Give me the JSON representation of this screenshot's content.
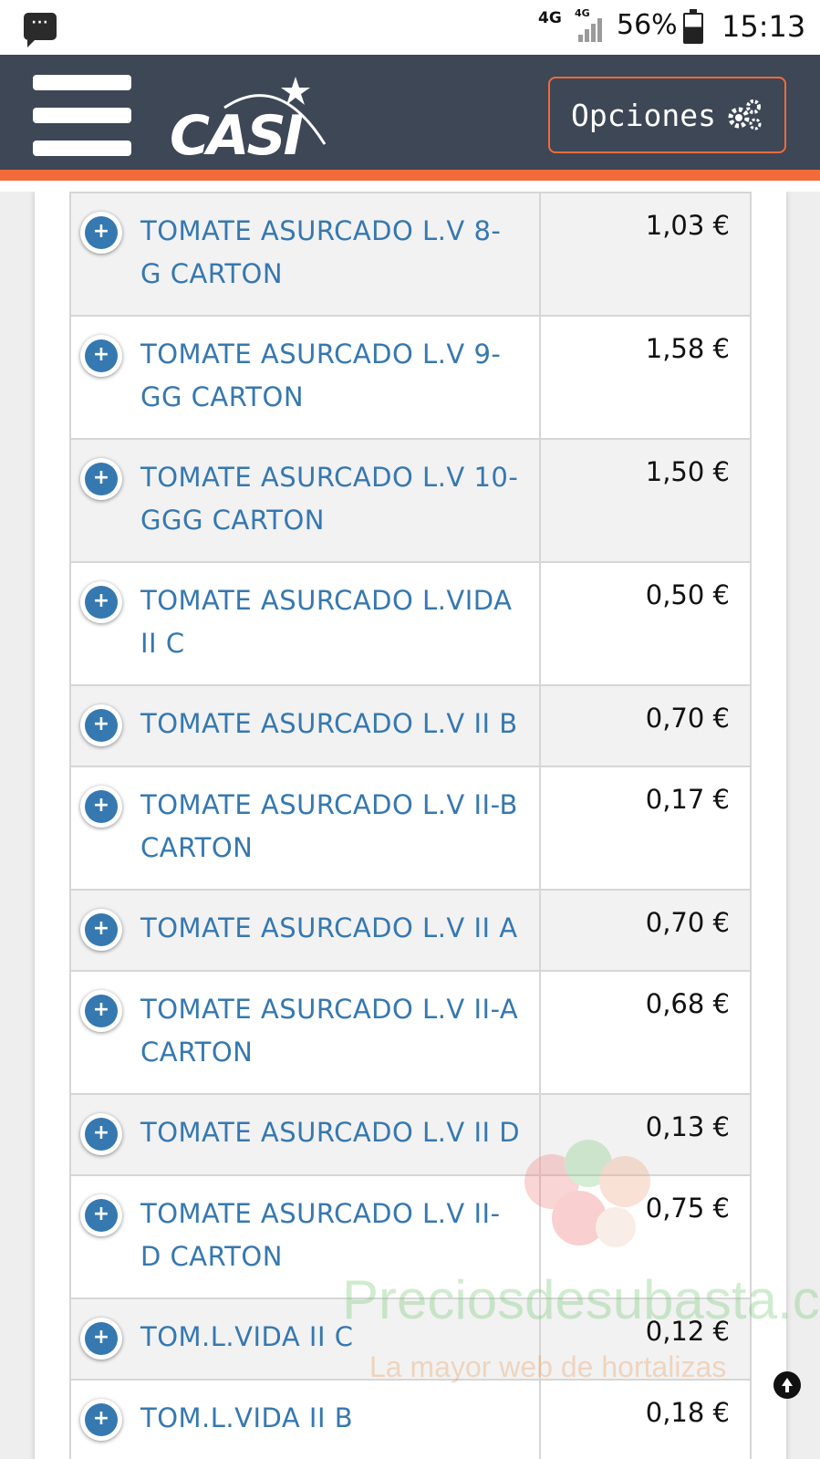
{
  "status_bar": {
    "network": "4G",
    "network_secondary": "4G",
    "battery": "56%",
    "time": "15:13"
  },
  "header": {
    "logo_text": "CASI",
    "options_label": "Opciones",
    "accent_color": "#f26b3a",
    "bg_color": "#3d4756"
  },
  "products": [
    {
      "name": "TOMATE ASURCADO L.V 8-G CARTON",
      "price": "1,03 €"
    },
    {
      "name": "TOMATE ASURCADO L.V 9-GG CARTON",
      "price": "1,58 €"
    },
    {
      "name": "TOMATE ASURCADO L.V 10-GGG CARTON",
      "price": "1,50 €"
    },
    {
      "name": "TOMATE ASURCADO L.VIDA II C",
      "price": "0,50 €"
    },
    {
      "name": "TOMATE ASURCADO L.V II B",
      "price": "0,70 €"
    },
    {
      "name": "TOMATE ASURCADO L.V II-B CARTON",
      "price": "0,17 €"
    },
    {
      "name": "TOMATE ASURCADO L.V II A",
      "price": "0,70 €"
    },
    {
      "name": "TOMATE ASURCADO L.V II-A CARTON",
      "price": "0,68 €"
    },
    {
      "name": "TOMATE ASURCADO L.V II D",
      "price": "0,13 €"
    },
    {
      "name": "TOMATE ASURCADO L.V II-D CARTON",
      "price": "0,75 €"
    },
    {
      "name": "TOM.L.VIDA II C",
      "price": "0,12 €"
    },
    {
      "name": "TOM.L.VIDA II B",
      "price": "0,18 €"
    }
  ],
  "watermark": {
    "title": "Preciosdesubasta.com",
    "subtitle": "La mayor web de hortalizas"
  }
}
